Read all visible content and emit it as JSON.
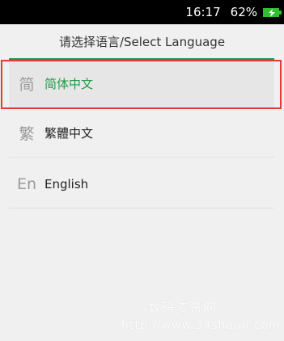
{
  "status_bar": {
    "time": "16:17",
    "battery_percent": "62%",
    "battery_icon": "charging-battery-icon",
    "battery_color": "#2fbf2f"
  },
  "header": {
    "title": "请选择语言/Select Language",
    "accent": "#1f9a45"
  },
  "languages": [
    {
      "glyph": "简",
      "label": "简体中文",
      "selected": true
    },
    {
      "glyph": "繁",
      "label": "繁體中文",
      "selected": false
    },
    {
      "glyph": "En",
      "label": "English",
      "selected": false
    }
  ],
  "selection_highlight_color": "#e53935",
  "watermark": {
    "line1": "数码资讯网",
    "line2": "http://www.34shouji.com"
  }
}
